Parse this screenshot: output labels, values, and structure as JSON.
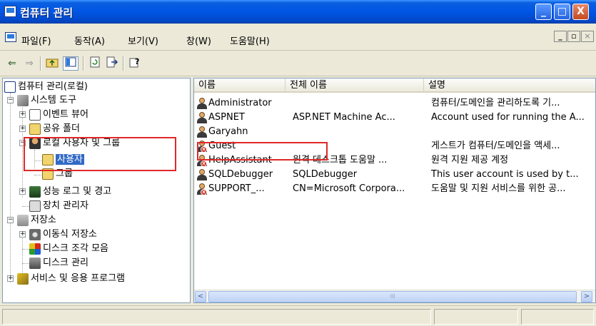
{
  "window": {
    "title": "컴퓨터 관리",
    "buttons": {
      "minimize": "_",
      "maximize": "□",
      "close": "X"
    }
  },
  "menubar": {
    "items": [
      "파일(F)",
      "동작(A)",
      "보기(V)",
      "창(W)",
      "도움말(H)"
    ],
    "mdi": {
      "minimize": "_",
      "restore": "▫",
      "close": "×"
    }
  },
  "toolbar": {
    "icons": [
      "back-arrow-icon",
      "forward-arrow-icon",
      "up-folder-icon",
      "show-tree-icon",
      "refresh-icon",
      "export-list-icon",
      "help-icon"
    ]
  },
  "tree": {
    "root": "컴퓨터 관리(로컬)",
    "nodes": [
      {
        "label": "시스템 도구",
        "level": 1,
        "expanded": true
      },
      {
        "label": "이벤트 뷰어",
        "level": 2,
        "expanded": false
      },
      {
        "label": "공유 폴더",
        "level": 2,
        "expanded": false
      },
      {
        "label": "로컬 사용자 및 그룹",
        "level": 2,
        "expanded": true
      },
      {
        "label": "사용자",
        "level": 3,
        "selected": true
      },
      {
        "label": "그룹",
        "level": 3
      },
      {
        "label": "성능 로그 및 경고",
        "level": 2,
        "expanded": false
      },
      {
        "label": "장치 관리자",
        "level": 2
      },
      {
        "label": "저장소",
        "level": 1,
        "expanded": true
      },
      {
        "label": "이동식 저장소",
        "level": 2,
        "expanded": false
      },
      {
        "label": "디스크 조각 모음",
        "level": 2
      },
      {
        "label": "디스크 관리",
        "level": 2
      },
      {
        "label": "서비스 및 응용 프로그램",
        "level": 1,
        "expanded": false
      }
    ]
  },
  "list": {
    "columns": [
      "이름",
      "전체 이름",
      "설명"
    ],
    "rows": [
      {
        "name": "Administrator",
        "fullname": "",
        "description": "컴퓨터/도메인을 관리하도록 기...",
        "disabled": false
      },
      {
        "name": "ASPNET",
        "fullname": "ASP.NET Machine Ac...",
        "description": "Account used for running the A...",
        "disabled": false
      },
      {
        "name": "Garyahn",
        "fullname": "",
        "description": "",
        "disabled": false
      },
      {
        "name": "Guest",
        "fullname": "",
        "description": "게스트가 컴퓨터/도메인을 액세...",
        "disabled": true
      },
      {
        "name": "HelpAssistant",
        "fullname": "원격 데스크톱 도움말 ...",
        "description": "원격 지원 제공 계정",
        "disabled": true
      },
      {
        "name": "SQLDebugger",
        "fullname": "SQLDebugger",
        "description": "This user account is used by t...",
        "disabled": false
      },
      {
        "name": "SUPPORT_...",
        "fullname": "CN=Microsoft Corpora...",
        "description": "도움말 및 지원 서비스를 위한 공...",
        "disabled": true
      }
    ]
  },
  "scrollbar": {
    "left": "<",
    "right": ">",
    "thumb": "III"
  },
  "colors": {
    "titlebar": "#0055e5",
    "selection": "#316ac5",
    "annotation": "#e02828"
  }
}
